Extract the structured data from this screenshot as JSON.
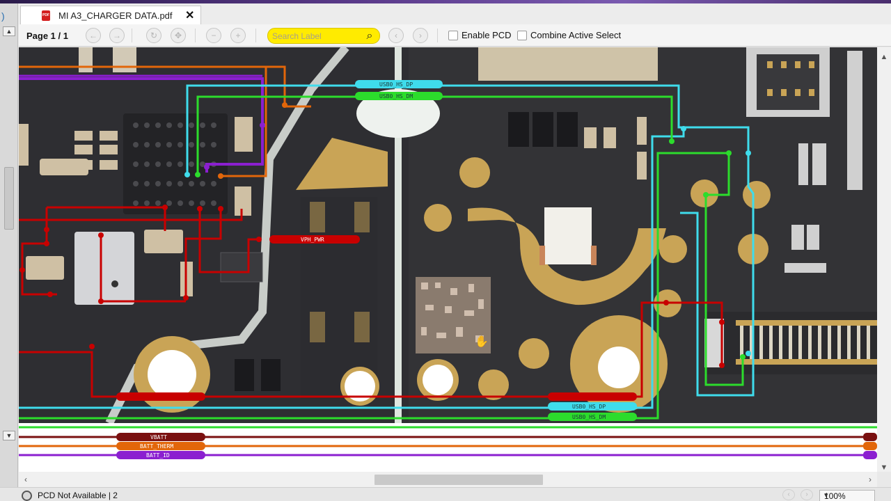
{
  "tab": {
    "title": "MI A3_CHARGER DATA.pdf",
    "file_type": "PDF"
  },
  "toolbar": {
    "page_label": "Page 1 / 1",
    "search_placeholder": "Search Label",
    "enable_pcd_label": "Enable PCD",
    "combine_label": "Combine Active Select"
  },
  "nets": {
    "usb_dp": "USB0_HS_DP",
    "usb_dm": "USB0_HS_DM",
    "vph_pwr": "VPH_PWR",
    "vbatt": "VBATT",
    "batt_therm": "BATT_THERM",
    "batt_id": "BATT_ID"
  },
  "status": {
    "text": "PCD Not Available | 2",
    "zoom": "100%"
  },
  "colors": {
    "search_bg": "#ffeb00",
    "net_red": "#c80000",
    "net_green": "#2cdc2c",
    "net_cyan": "#3fdcec",
    "net_orange": "#e2660a",
    "net_purple": "#8b1fd0"
  }
}
